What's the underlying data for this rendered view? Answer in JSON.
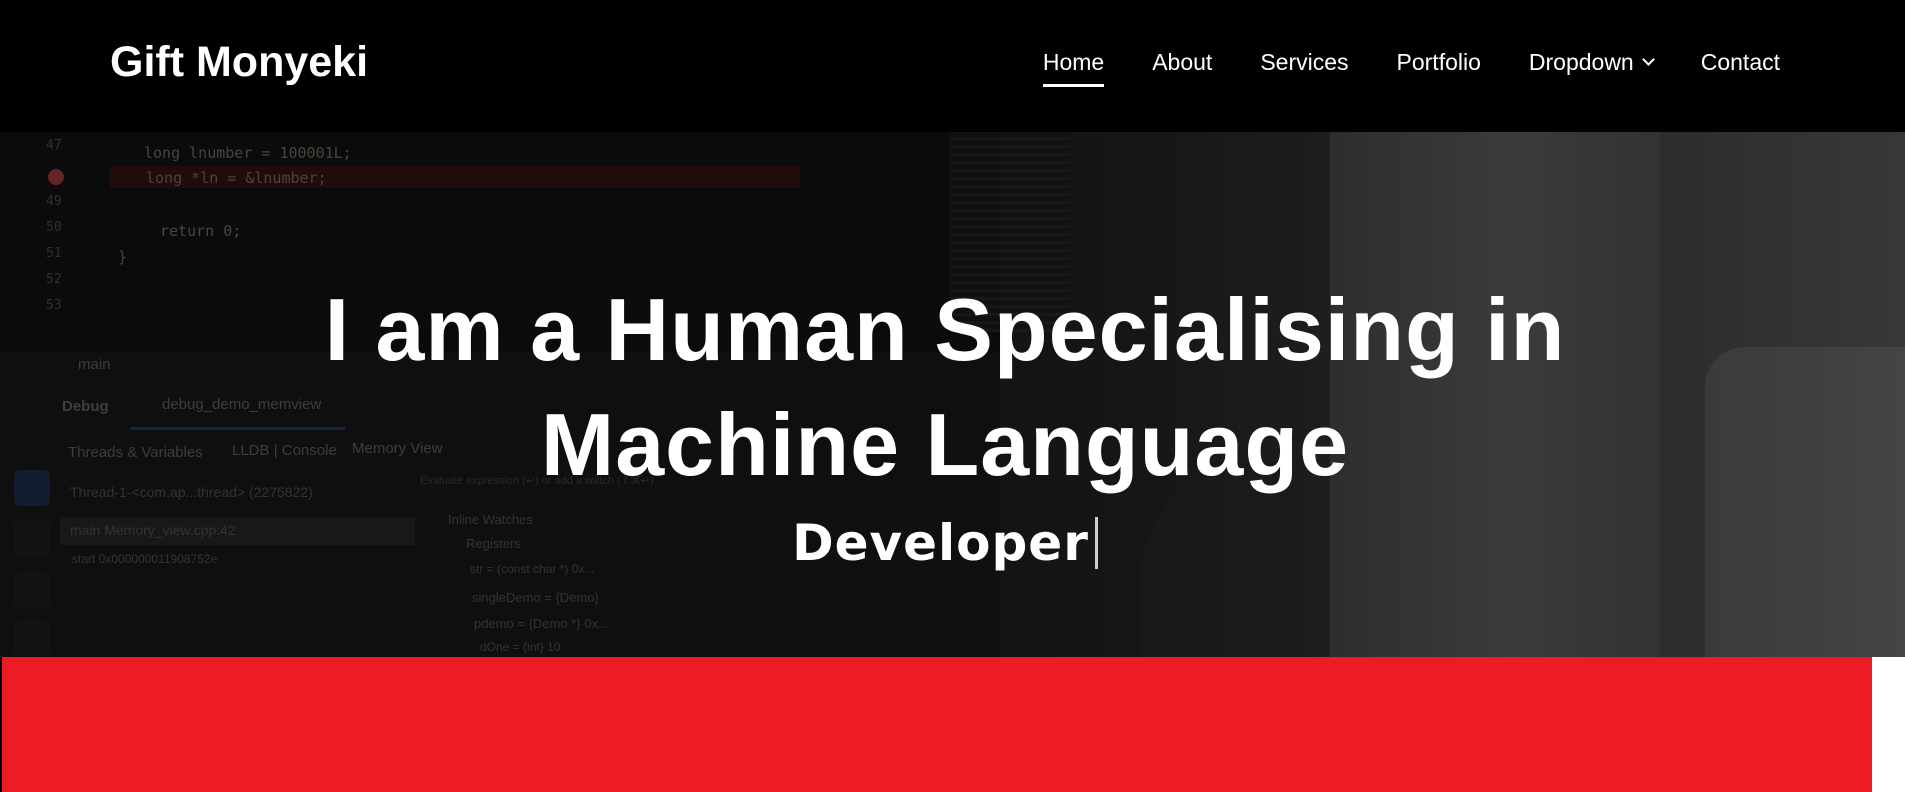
{
  "header": {
    "logo": "Gift Monyeki",
    "nav": [
      {
        "label": "Home",
        "active": true
      },
      {
        "label": "About"
      },
      {
        "label": "Services"
      },
      {
        "label": "Portfolio"
      },
      {
        "label": "Dropdown",
        "has_dropdown": true
      },
      {
        "label": "Contact"
      }
    ]
  },
  "hero": {
    "title_line1": "I am a Human Specialising in",
    "title_line2": "Machine Language",
    "subtitle": "Developer",
    "background_code": {
      "line_numbers": [
        "47",
        "49",
        "50",
        "51",
        "52",
        "53"
      ],
      "lines": [
        "long lnumber = 100001L;",
        "long *ln = &lnumber;",
        "return 0;",
        "}"
      ],
      "tabs": [
        "main",
        "Debug",
        "debug_demo_memview",
        "Threads & Variables",
        "LLDB | Console",
        "Memory View"
      ],
      "tree": [
        "Thread-1-<com.ap...thread> (2275822)",
        "main Memory_view.cpp:42",
        "start 0x000000011908752e",
        "Inline Watches",
        "Registers",
        "str = (const char *) 0x...",
        "singleDemo = {Demo}",
        "pdemo = {Demo *} 0x...",
        "dOne = {int} 10"
      ],
      "watch_placeholder": "Evaluate expression (↵) or add a watch (⇧⌘↵)"
    }
  },
  "colors": {
    "header_bg": "#000000",
    "accent_red": "#ed1c24",
    "text": "#ffffff"
  }
}
